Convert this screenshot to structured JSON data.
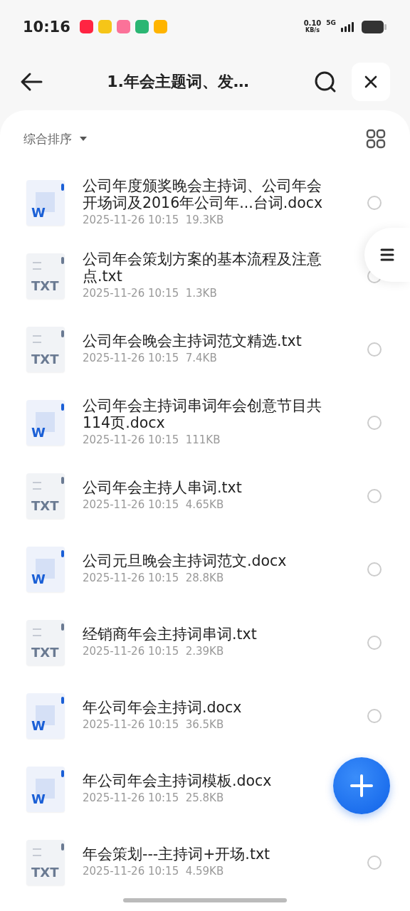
{
  "status_bar": {
    "time": "10:16",
    "speed": "0.10",
    "speed_unit": "KB/s",
    "network": "5G"
  },
  "header": {
    "title": "1.年会主题词、发…"
  },
  "toolbar": {
    "sort_label": "综合排序"
  },
  "files": [
    {
      "kind": "docx",
      "icon_label": "W",
      "name": "公司年度颁奖晚会主持词、公司年会开场词及2016年公司年...台词.docx",
      "date": "2025-11-26 10:15",
      "size": "19.3KB",
      "selected": false
    },
    {
      "kind": "txt",
      "icon_label": "TXT",
      "name": "公司年会策划方案的基本流程及注意点.txt",
      "date": "2025-11-26 10:15",
      "size": "1.3KB",
      "selected": false
    },
    {
      "kind": "txt",
      "icon_label": "TXT",
      "name": "公司年会晚会主持词范文精选.txt",
      "date": "2025-11-26 10:15",
      "size": "7.4KB",
      "selected": false
    },
    {
      "kind": "docx",
      "icon_label": "W",
      "name": "公司年会主持词串词年会创意节目共114页.docx",
      "date": "2025-11-26 10:15",
      "size": "111KB",
      "selected": false
    },
    {
      "kind": "txt",
      "icon_label": "TXT",
      "name": "公司年会主持人串词.txt",
      "date": "2025-11-26 10:15",
      "size": "4.65KB",
      "selected": false
    },
    {
      "kind": "docx",
      "icon_label": "W",
      "name": "公司元旦晚会主持词范文.docx",
      "date": "2025-11-26 10:15",
      "size": "28.8KB",
      "selected": false
    },
    {
      "kind": "txt",
      "icon_label": "TXT",
      "name": "经销商年会主持词串词.txt",
      "date": "2025-11-26 10:15",
      "size": "2.39KB",
      "selected": false
    },
    {
      "kind": "docx",
      "icon_label": "W",
      "name": "年公司年会主持词.docx",
      "date": "2025-11-26 10:15",
      "size": "36.5KB",
      "selected": false
    },
    {
      "kind": "docx",
      "icon_label": "W",
      "name": "年公司年会主持词模板.docx",
      "date": "2025-11-26 10:15",
      "size": "25.8KB"
    },
    {
      "kind": "txt",
      "icon_label": "TXT",
      "name": "年会策划---主持词+开场.txt",
      "date": "2025-11-26 10:15",
      "size": "4.59KB",
      "selected": false
    }
  ]
}
